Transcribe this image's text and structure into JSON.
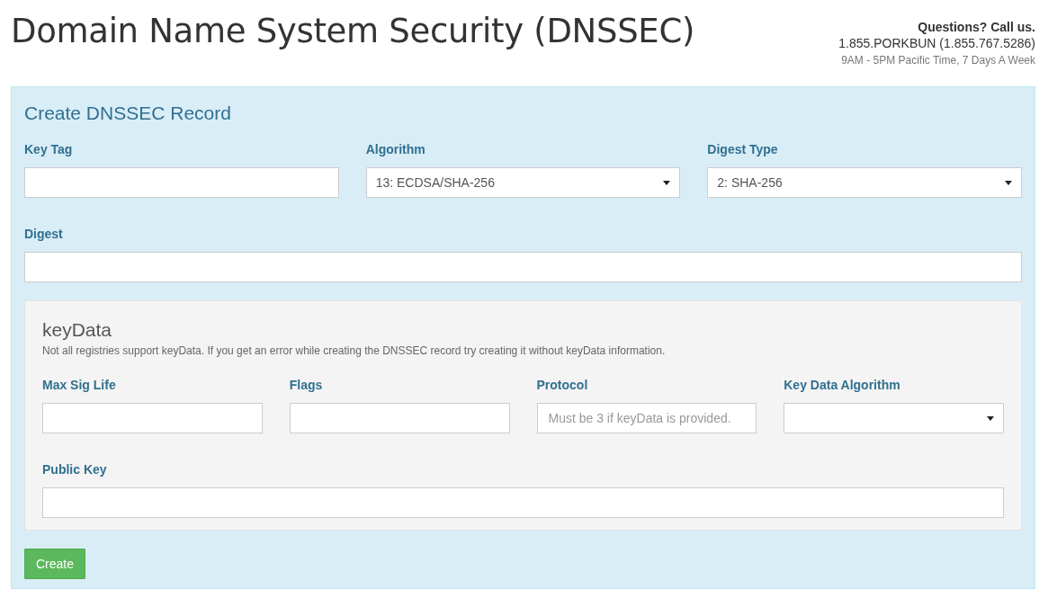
{
  "page": {
    "title": "Domain Name System Security (DNSSEC)"
  },
  "contact": {
    "heading": "Questions? Call us.",
    "phone": "1.855.PORKBUN (1.855.767.5286)",
    "hours": "9AM - 5PM Pacific Time, 7 Days A Week"
  },
  "panel": {
    "title": "Create DNSSEC Record",
    "rows": [
      [
        {
          "label": "Key Tag",
          "kind": "text"
        },
        {
          "label": "Algorithm",
          "kind": "select",
          "value": "13: ECDSA/SHA-256"
        },
        {
          "label": "Digest Type",
          "kind": "select",
          "value": "2: SHA-256"
        }
      ],
      [
        {
          "label": "Digest",
          "kind": "text"
        }
      ]
    ]
  },
  "key_data": {
    "title": "keyData",
    "note": "Not all registries support keyData. If you get an error while creating the DNSSEC record try creating it without keyData information.",
    "rows": [
      [
        {
          "label": "Max Sig Life",
          "kind": "text"
        },
        {
          "label": "Flags",
          "kind": "text"
        },
        {
          "label": "Protocol",
          "kind": "text",
          "placeholder": "Must be 3 if keyData is provided."
        },
        {
          "label": "Key Data Algorithm",
          "kind": "select"
        }
      ],
      [
        {
          "label": "Public Key",
          "kind": "text"
        }
      ]
    ]
  },
  "button": {
    "label": "Create"
  }
}
